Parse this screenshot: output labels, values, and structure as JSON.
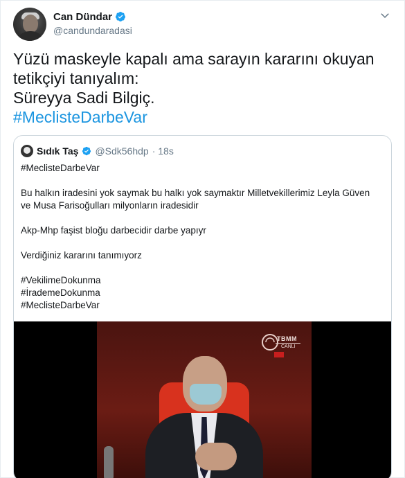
{
  "tweet": {
    "author": {
      "display_name": "Can Dündar",
      "handle": "@candundaradasi",
      "verified": true
    },
    "text_lines": [
      "Yüzü maskeyle kapalı ama sarayın kararını okuyan",
      "tetikçiyi tanıyalım:",
      "Süreyya Sadi Bilgiç."
    ],
    "hashtag": "#MeclisteDarbeVar",
    "menu_icon": "chevron-down-icon",
    "verified_icon": "verified-badge-icon"
  },
  "quote": {
    "author": {
      "display_name": "Sıdık Taş",
      "handle": "@Sdk56hdp",
      "time": "· 18s",
      "verified": true
    },
    "paragraphs": [
      "#MeclisteDarbeVar",
      "Bu halkın iradesini yok saymak bu halkı yok saymaktır Milletvekillerimiz Leyla Güven ve Musa Farisoğulları milyonların iradesidir",
      "Akp-Mhp faşist bloğu darbecidir darbe yapıyr",
      "Verdiğiniz kararını tanımıyorz"
    ],
    "tags": [
      "#VekilimeDokunma",
      "#İrademeDokunma",
      "#MeclisteDarbeVar"
    ],
    "video": {
      "channel_logo": "TBMM",
      "channel_sub": "CANLI"
    }
  },
  "colors": {
    "link": "#1b95e0",
    "verified": "#1da1f2",
    "muted": "#657786",
    "border": "#ccd6dd"
  }
}
